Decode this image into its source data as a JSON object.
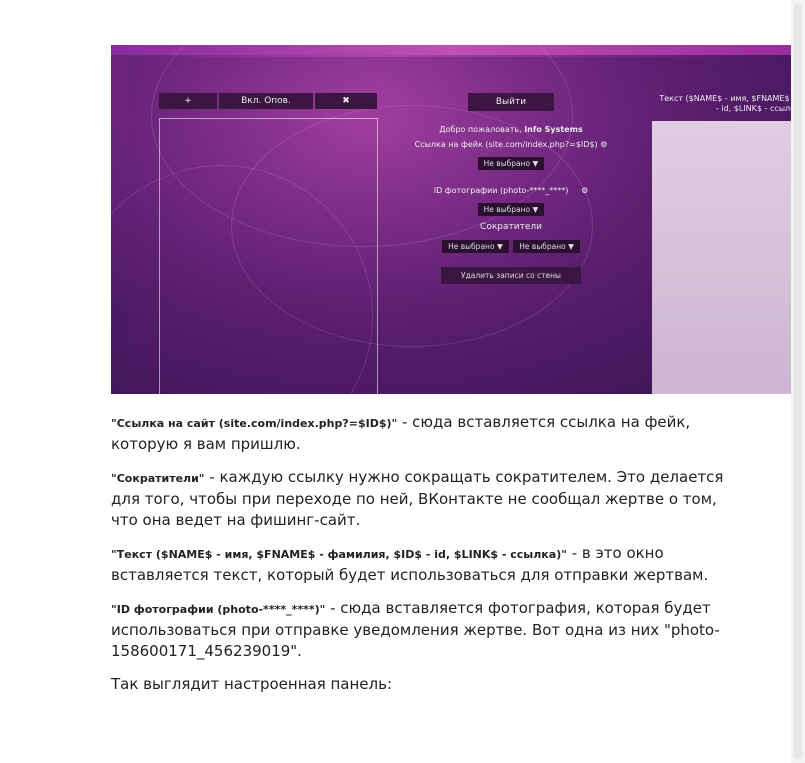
{
  "screenshot": {
    "left_buttons": {
      "add_icon": "+",
      "toggle_label": "Вкл. Опов.",
      "close_icon": "✖"
    },
    "exit_label": "Выйти",
    "welcome_prefix": "Добро пожаловать,",
    "welcome_user": "Info Systems",
    "fake_link_label": "Ссылка на фейк (site.com/index.php?=$ID$)",
    "gear_icon": "⚙",
    "not_selected": "Не выбрано",
    "photo_id_label": "ID фотографии (photo-****_****)",
    "shorteners_label": "Сократители",
    "delete_label": "Удалить записи со стены",
    "text_label_line1": "Текст ($NAME$ - имя, $FNAME$ -",
    "text_label_line2": "- id, $LINK$ - ссылк",
    "dropdown_arrow": "▼"
  },
  "article": [
    {
      "bold": "\"Ссылка на сайт (site.com/index.php?=$ID$)\"",
      "text": " - сюда вставляется ссылка на фейк, которую я вам пришлю."
    },
    {
      "bold": "\"Сократители\"",
      "text": " - каждую ссылку нужно сокращать сократителем. Это делается для того, чтобы при переходе по ней, ВКонтакте не сообщал жертве о том, что она ведет на фишинг-сайт."
    },
    {
      "bold": "\"Текст ($NAME$ - имя, $FNAME$ - фамилия, $ID$ - id, $LINK$ - ссылка)\"",
      "text": " - в это окно вставляется текст, который будет использоваться для отправки жертвам."
    },
    {
      "bold": "\"ID фотографии (photo-****_****)\"",
      "text": " - сюда вставляется фотография, которая будет использоваться при отправке уведомления жертве. Вот одна из них \"photo-158600171_456239019\"."
    },
    {
      "bold": "",
      "text": "Так выглядит настроенная панель:"
    }
  ]
}
